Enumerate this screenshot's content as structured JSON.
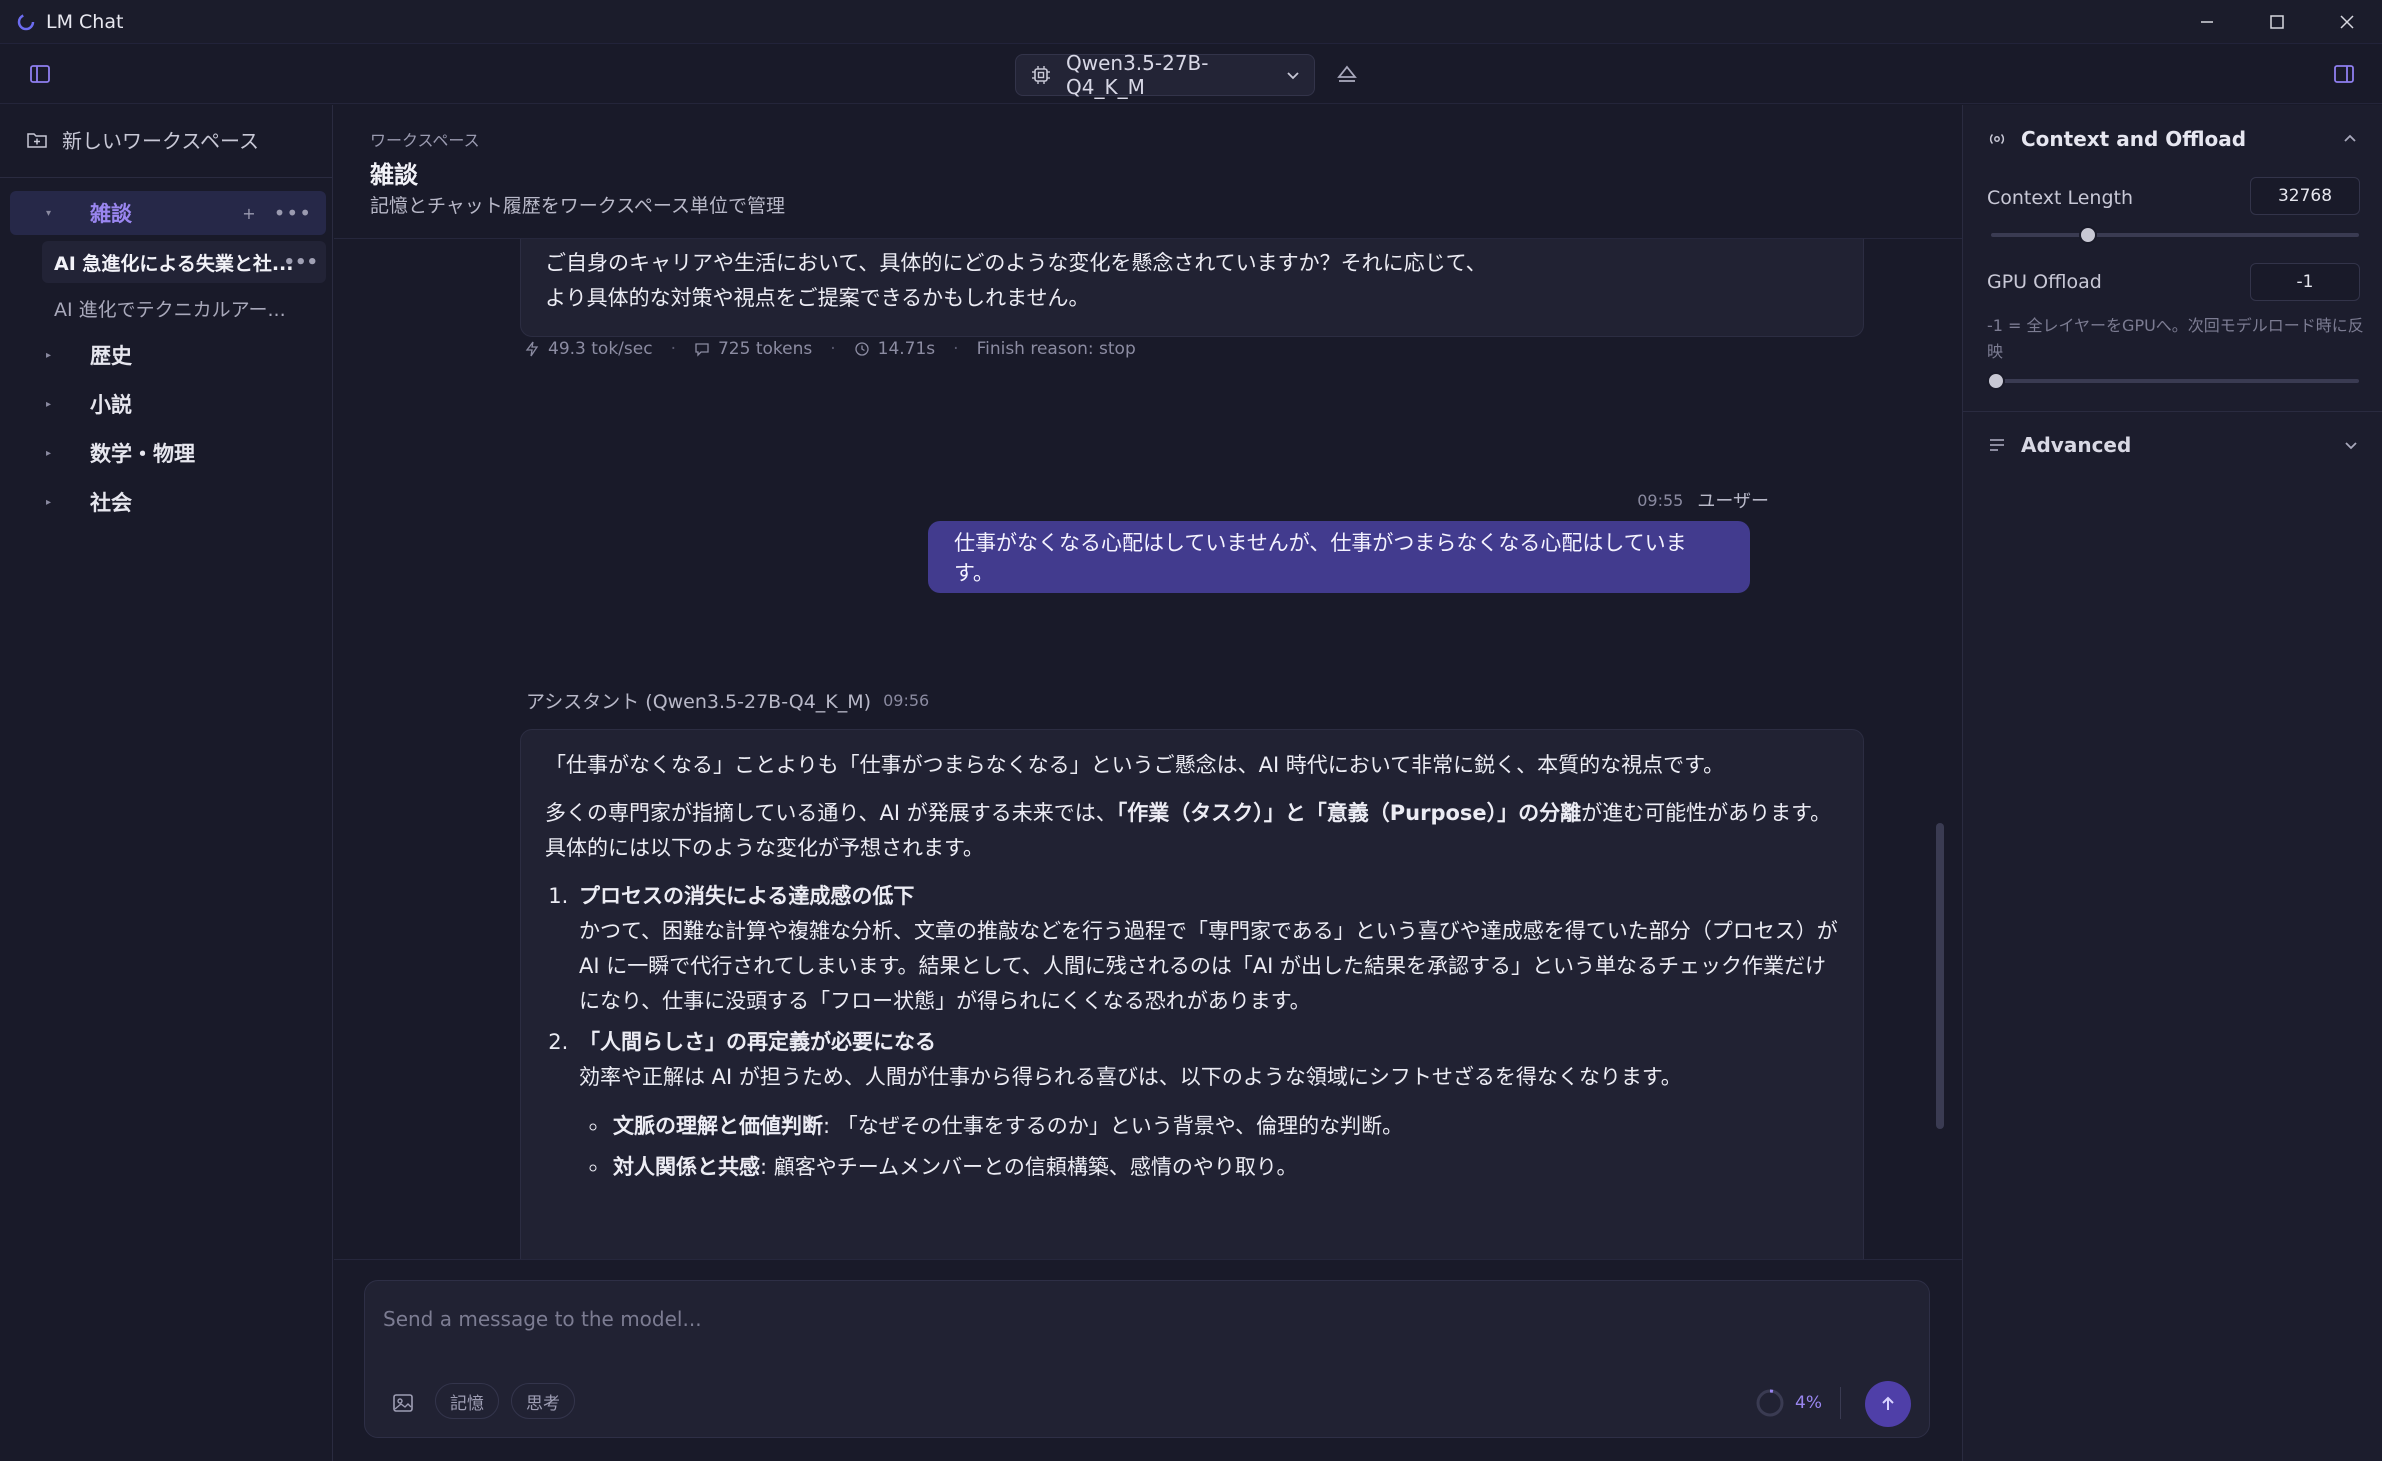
{
  "app": {
    "title": "LM Chat"
  },
  "toolbar": {
    "model_name": "Qwen3.5-27B-Q4_K_M"
  },
  "sidebar": {
    "new_workspace_label": "新しいワークスペース",
    "workspaces": [
      {
        "label": "雑談",
        "expanded": true,
        "active": true
      },
      {
        "label": "歴史",
        "expanded": false
      },
      {
        "label": "小説",
        "expanded": false
      },
      {
        "label": "数学・物理",
        "expanded": false
      },
      {
        "label": "社会",
        "expanded": false
      }
    ],
    "chats": [
      {
        "label": "AI 急進化による失業と社...",
        "active": true
      },
      {
        "label": "AI 進化でテクニカルアー...",
        "active": false
      }
    ]
  },
  "workspace": {
    "kicker": "ワークスペース",
    "title": "雑談",
    "description": "記憶とチャット履歴をワークスペース単位で管理"
  },
  "messages": {
    "previous": {
      "line1": "ご自身のキャリアや生活において、具体的にどのような変化を懸念されていますか？それに応じて、",
      "line2": "より具体的な対策や視点をご提案できるかもしれません。"
    },
    "stats": {
      "speed": "49.3 tok/sec",
      "tokens": "725 tokens",
      "time": "14.71s",
      "finish": "Finish reason: stop"
    },
    "user": {
      "time": "09:55",
      "role": "ユーザー",
      "text": "仕事がなくなる心配はしていませんが、仕事がつまらなくなる心配はしています。"
    },
    "assistant": {
      "role": "アシスタント (Qwen3.5-27B-Q4_K_M)",
      "time": "09:56",
      "p1": "「仕事がなくなる」ことよりも「仕事がつまらなくなる」というご懸念は、AI 時代において非常に鋭く、本質的な視点です。",
      "p2_pre": "多くの専門家が指摘している通り、AI が発展する未来では、",
      "p2_bold": "「作業（タスク）」と「意義（Purpose）」の分離",
      "p2_post": "が進む可能性があります。具体的には以下のような変化が予想されます。",
      "item1_title": "プロセスの消失による達成感の低下",
      "item1_body": "かつて、困難な計算や複雑な分析、文章の推敲などを行う過程で「専門家である」という喜びや達成感を得ていた部分（プロセス）が AI に一瞬で代行されてしまいます。結果として、人間に残されるのは「AI が出した結果を承認する」という単なるチェック作業だけになり、仕事に没頭する「フロー状態」が得られにくくなる恐れがあります。",
      "item2_title": "「人間らしさ」の再定義が必要になる",
      "item2_body": "効率や正解は AI が担うため、人間が仕事から得られる喜びは、以下のような領域にシフトせざるを得なくなります。",
      "sub1_title": "文脈の理解と価値判断",
      "sub1_body": ": 「なぜその仕事をするのか」という背景や、倫理的な判断。",
      "sub2_title": "対人関係と共感",
      "sub2_body": ": 顧客やチームメンバーとの信頼構築、感情のやり取り。"
    }
  },
  "composer": {
    "placeholder": "Send a message to the model...",
    "chip_memory": "記憶",
    "chip_think": "思考",
    "context_usage": "4%"
  },
  "right_panel": {
    "section_title": "Context and Offload",
    "context_length_label": "Context Length",
    "context_length_value": "32768",
    "gpu_offload_label": "GPU Offload",
    "gpu_offload_value": "-1",
    "gpu_offload_hint": "-1 = 全レイヤーをGPUへ。次回モデルロード時に反映",
    "advanced_label": "Advanced"
  },
  "colors": {
    "accent": "#9a86f0",
    "user_bubble": "#423b8e",
    "send_button": "#4f3fa8"
  }
}
